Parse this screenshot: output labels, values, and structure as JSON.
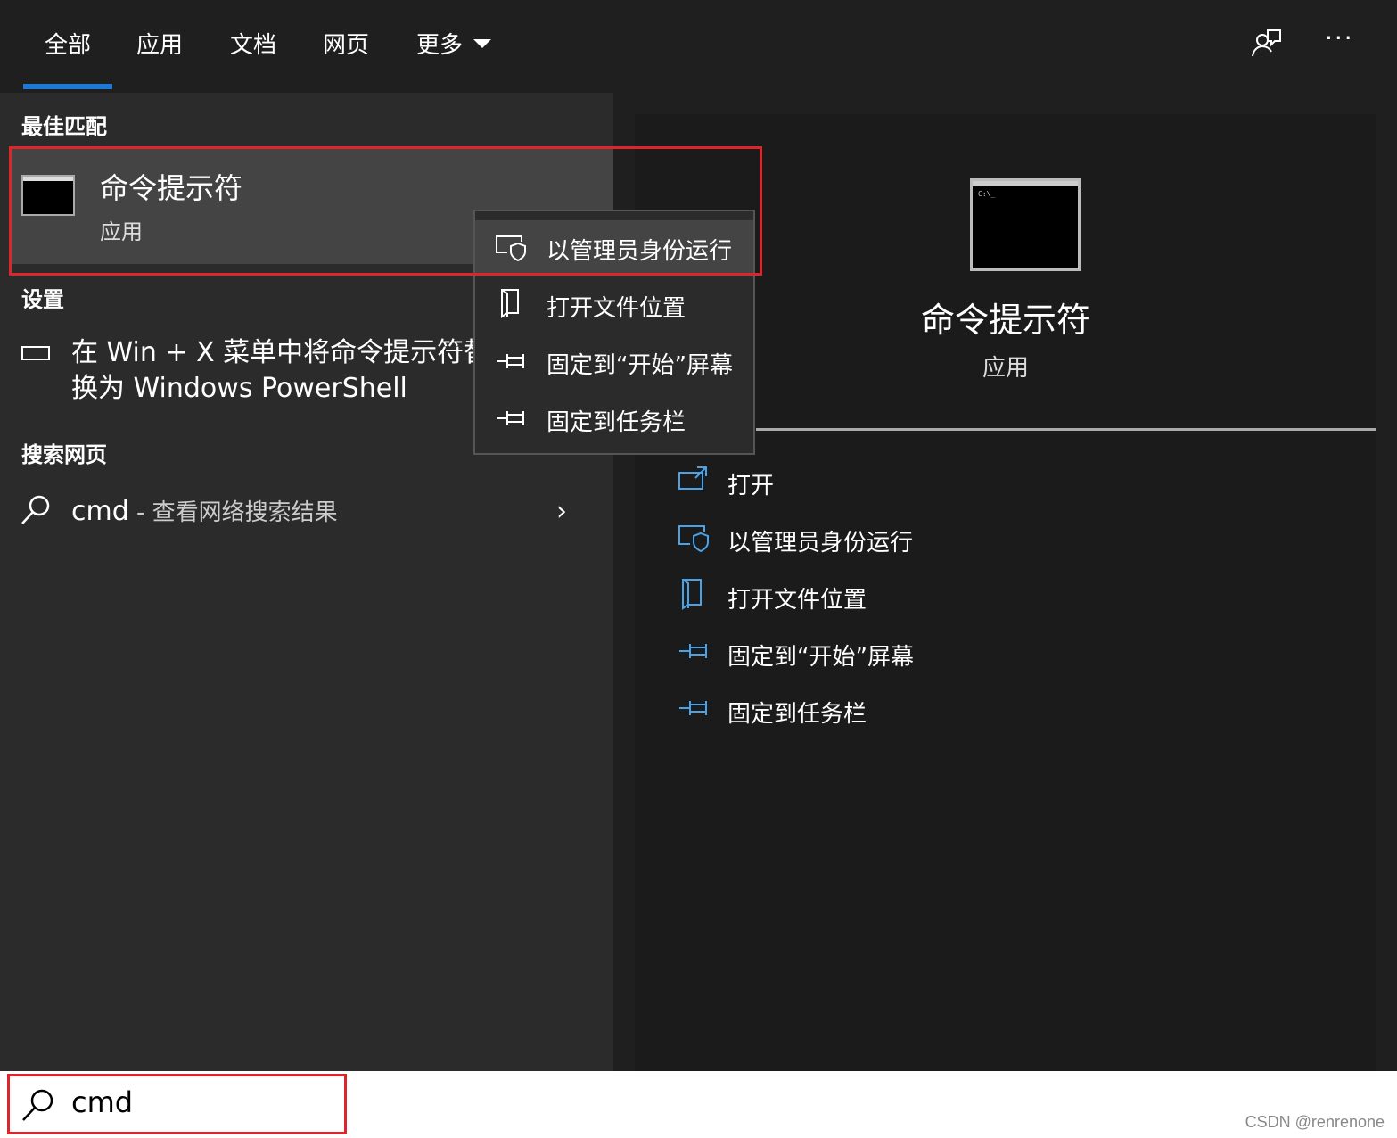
{
  "tabs": [
    {
      "label": "全部",
      "active": true
    },
    {
      "label": "应用"
    },
    {
      "label": "文档"
    },
    {
      "label": "网页"
    },
    {
      "label": "更多"
    }
  ],
  "top_icons": [
    "feedback-icon",
    "more-options-icon"
  ],
  "more_options_label": "···",
  "left": {
    "best_match_title": "最佳匹配",
    "best_match": {
      "name": "命令提示符",
      "type": "应用",
      "icon": "cmd-app-icon"
    },
    "settings_title": "设置",
    "setting_item": {
      "line1": "在 Win + X 菜单中将命令提示符替",
      "line2": "换为 Windows PowerShell",
      "icon": "display-icon"
    },
    "web_title": "搜索网页",
    "web_item": {
      "query": "cmd",
      "suffix": " - 查看网络搜索结果",
      "icon": "search-icon",
      "chevron": "›"
    }
  },
  "context_menu": [
    {
      "label": "以管理员身份运行",
      "icon": "admin-shield-icon",
      "highlighted": true
    },
    {
      "label": "打开文件位置",
      "icon": "file-location-icon"
    },
    {
      "label": "固定到“开始”屏幕",
      "icon": "pin-icon"
    },
    {
      "label": "固定到任务栏",
      "icon": "pin-icon"
    }
  ],
  "right": {
    "app_name": "命令提示符",
    "app_type": "应用",
    "icon_text": "C:\\_",
    "actions": [
      {
        "label": "打开",
        "icon": "open-icon"
      },
      {
        "label": "以管理员身份运行",
        "icon": "admin-shield-icon"
      },
      {
        "label": "打开文件位置",
        "icon": "file-location-icon"
      },
      {
        "label": "固定到“开始”屏幕",
        "icon": "pin-icon"
      },
      {
        "label": "固定到任务栏",
        "icon": "pin-icon"
      }
    ]
  },
  "search": {
    "value": "cmd",
    "icon": "search-icon"
  },
  "watermark": "CSDN @renrenone",
  "colors": {
    "accent": "#1e78d6",
    "highlight_box": "#e0242b",
    "icon_blue": "#4aa3e8"
  }
}
